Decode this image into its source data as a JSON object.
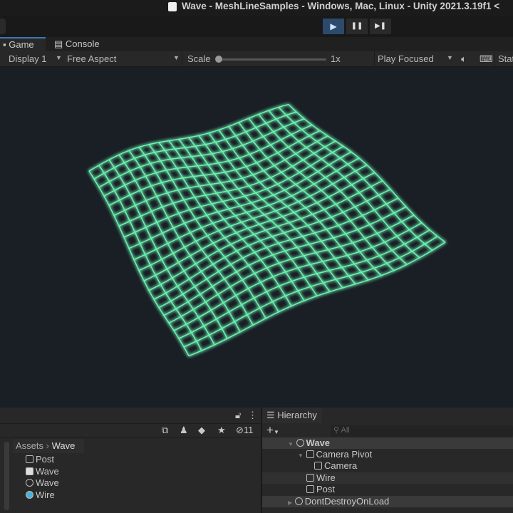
{
  "window": {
    "title": "Wave - MeshLineSamples - Windows, Mac, Linux - Unity 2021.3.19f1 <"
  },
  "toolbar": {
    "play": "▶",
    "pause": "❚❚",
    "step": "▶❚"
  },
  "tabs": [
    {
      "label": "Game"
    },
    {
      "label": "Console"
    }
  ],
  "gamebar": {
    "display": "Display 1",
    "aspect": "Free Aspect",
    "scale_label": "Scale",
    "scale_value": "1x",
    "scale_fraction": 0,
    "play_mode": "Play Focused",
    "stats": "Stats"
  },
  "project": {
    "hidden_count": "11",
    "breadcrumb": [
      "Assets",
      "Wave"
    ],
    "items": [
      {
        "label": "Post",
        "icon": "post-process-icon"
      },
      {
        "label": "Wave",
        "icon": "script-icon"
      },
      {
        "label": "Wave",
        "icon": "unity-scene-icon"
      },
      {
        "label": "Wire",
        "icon": "material-icon"
      }
    ]
  },
  "hierarchy": {
    "title": "Hierarchy",
    "search_placeholder": "All",
    "items": [
      {
        "label": "Wave"
      },
      {
        "label": "Camera Pivot"
      },
      {
        "label": "Camera"
      },
      {
        "label": "Wire"
      },
      {
        "label": "Post"
      },
      {
        "label": "DontDestroyOnLoad"
      }
    ]
  },
  "colors": {
    "wire": "#6cf0b0",
    "accent": "#3a79bb"
  }
}
